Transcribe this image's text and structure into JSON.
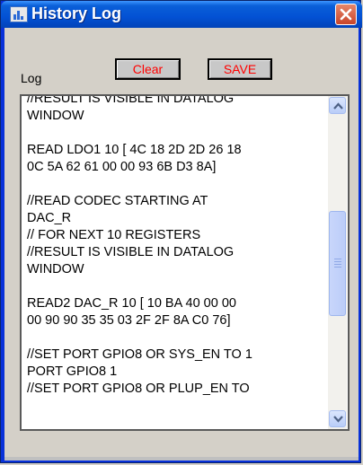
{
  "window": {
    "title": "History Log",
    "title_color": "#ffffff",
    "titlebar_color": "#0351d4"
  },
  "panel": {
    "log_label": "Log"
  },
  "buttons": {
    "clear_label": "Clear",
    "save_label": "SAVE",
    "label_color": "#ff0000"
  },
  "log": {
    "lines": [
      "//RESULT IS VISIBLE IN DATALOG",
      "WINDOW",
      "",
      "READ LDO1 10 [ 4C 18 2D 2D 26 18",
      "0C 5A 62 61 00 00 93 6B D3 8A]",
      "",
      "//READ CODEC STARTING AT",
      "DAC_R",
      "// FOR NEXT 10 REGISTERS",
      "//RESULT IS VISIBLE IN DATALOG",
      "WINDOW",
      "",
      "READ2 DAC_R 10 [ 10 BA 40 00 00",
      "00 90 90 35 35 03 2F 2F 8A C0 76]",
      "",
      "//SET PORT GPIO8 OR SYS_EN TO 1",
      "PORT GPIO8 1",
      "//SET PORT GPIO8 OR PLUP_EN TO"
    ]
  },
  "icons": {
    "close": "close-x-icon",
    "app": "app-window-icon",
    "scroll_up": "chevron-up-icon",
    "scroll_down": "chevron-down-icon"
  }
}
